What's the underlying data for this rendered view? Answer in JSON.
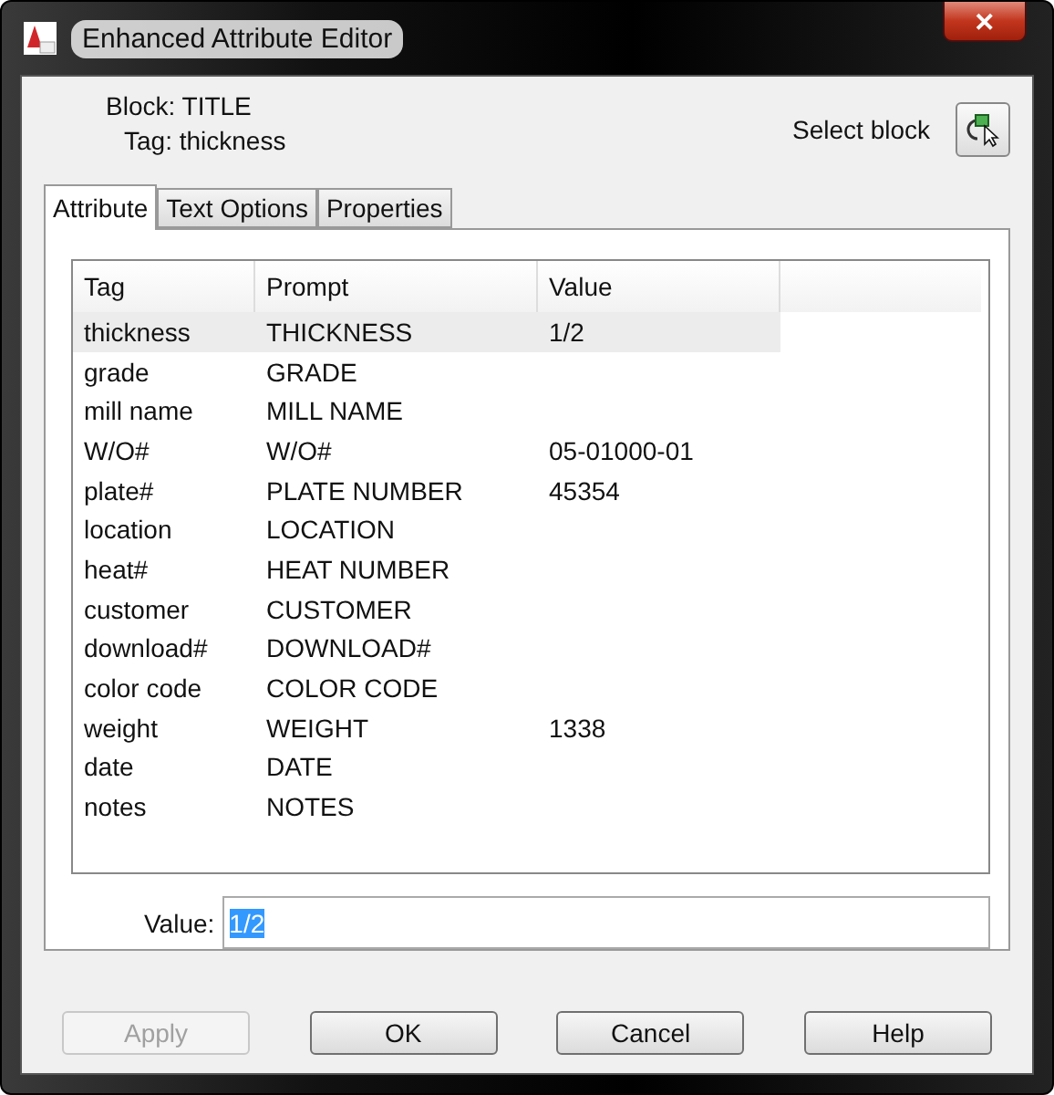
{
  "window": {
    "title": "Enhanced Attribute Editor",
    "close": "✕"
  },
  "header": {
    "block_label": "Block: TITLE",
    "tag_label": "Tag: thickness",
    "select_label": "Select block"
  },
  "tabs": [
    {
      "label": "Attribute",
      "selected": true
    },
    {
      "label": "Text Options",
      "selected": false
    },
    {
      "label": "Properties",
      "selected": false
    }
  ],
  "table": {
    "columns": [
      "Tag",
      "Prompt",
      "Value"
    ],
    "rows": [
      {
        "cells": [
          "thickness",
          "THICKNESS",
          "1/2"
        ],
        "selected": true
      },
      {
        "cells": [
          "grade",
          "GRADE",
          ""
        ],
        "selected": false
      },
      {
        "cells": [
          "mill name",
          "MILL NAME",
          ""
        ],
        "selected": false
      },
      {
        "cells": [
          "W/O#",
          "W/O#",
          "05-01000-01"
        ],
        "selected": false
      },
      {
        "cells": [
          "plate#",
          "PLATE NUMBER",
          "45354"
        ],
        "selected": false
      },
      {
        "cells": [
          "location",
          "LOCATION",
          ""
        ],
        "selected": false
      },
      {
        "cells": [
          "heat#",
          "HEAT NUMBER",
          ""
        ],
        "selected": false
      },
      {
        "cells": [
          "customer",
          "CUSTOMER",
          ""
        ],
        "selected": false
      },
      {
        "cells": [
          "download#",
          "DOWNLOAD#",
          ""
        ],
        "selected": false
      },
      {
        "cells": [
          "color code",
          "COLOR CODE",
          ""
        ],
        "selected": false
      },
      {
        "cells": [
          "weight",
          "WEIGHT",
          "1338"
        ],
        "selected": false
      },
      {
        "cells": [
          "date",
          "DATE",
          ""
        ],
        "selected": false
      },
      {
        "cells": [
          "notes",
          "NOTES",
          ""
        ],
        "selected": false
      }
    ]
  },
  "value_field": {
    "label": "Value:",
    "value": "1/2",
    "text_selected": true
  },
  "buttons": [
    {
      "label": "Apply",
      "disabled": true
    },
    {
      "label": "OK",
      "disabled": false
    },
    {
      "label": "Cancel",
      "disabled": false
    },
    {
      "label": "Help",
      "disabled": false
    }
  ]
}
